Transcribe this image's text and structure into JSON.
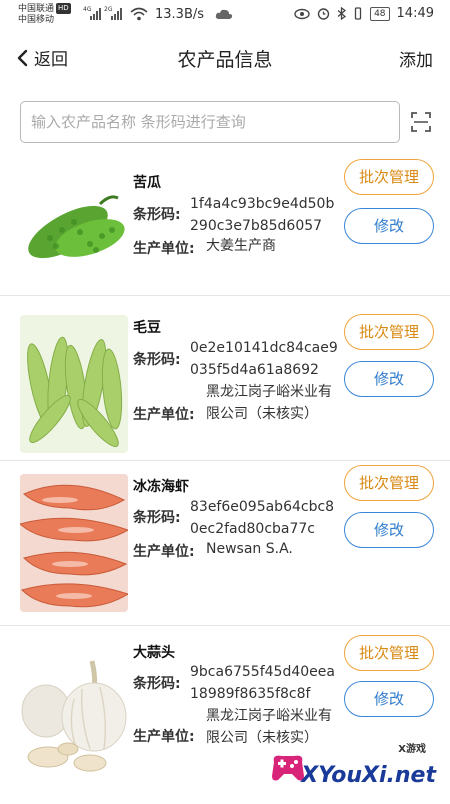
{
  "status_bar": {
    "carrier_1": "中国联通",
    "hd_badge": "HD",
    "carrier_2": "中国移动",
    "gen_1": "4G",
    "gen_2": "2G",
    "net_speed": "13.3B/s",
    "battery": "48",
    "time": "14:49"
  },
  "header": {
    "back_label": "返回",
    "title": "农产品信息",
    "action_label": "添加"
  },
  "search": {
    "placeholder": "输入农产品名称 条形码进行查询"
  },
  "labels": {
    "barcode": "条形码:",
    "producer": "生产单位:",
    "batch_button": "批次管理",
    "edit_button": "修改"
  },
  "products": [
    {
      "name": "苦瓜",
      "barcode": "1f4a4c93bc9e4d50b290c3e7b85d6057",
      "producer": "大姜生产商"
    },
    {
      "name": "毛豆",
      "barcode": "0e2e10141dc84cae9035f5d4a61a8692",
      "producer": "黑龙江岗子峪米业有限公司（未核实）"
    },
    {
      "name": "冰冻海虾",
      "barcode": "83ef6e095ab64cbc80ec2fad80cba77c",
      "producer": "Newsan S.A."
    },
    {
      "name": "大蒜头",
      "barcode": "9bca6755f45d40eea18989f8635f8c8f",
      "producer": "黑龙江岗子峪米业有限公司（未核实）"
    }
  ],
  "watermark": {
    "small": "X游戏",
    "brand": "XYouXi.net"
  }
}
